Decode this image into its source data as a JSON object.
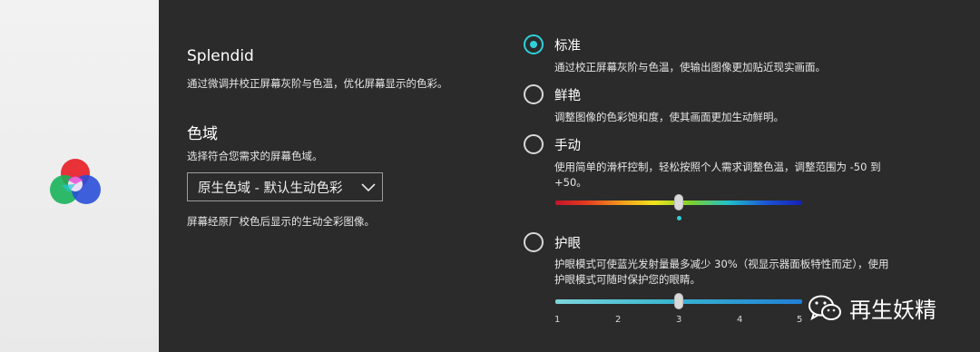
{
  "left": {
    "logo_icon": "color-gamut-logo"
  },
  "splendid": {
    "title": "Splendid",
    "description": "通过微调并校正屏幕灰阶与色温，优化屏幕显示的色彩。"
  },
  "gamut": {
    "title": "色域",
    "description": "选择符合您需求的屏幕色域。",
    "selected_value": "原生色域 - 默认生动色彩",
    "note": "屏幕经原厂校色后显示的生动全彩图像。"
  },
  "modes": [
    {
      "label": "标准",
      "selected": true,
      "description": [
        "通过校正屏幕灰阶与色温，使输出图像更加贴近现实画面。"
      ]
    },
    {
      "label": "鲜艳",
      "selected": false,
      "description": [
        "调整图像的色彩饱和度，使其画面更加生动鲜明。"
      ]
    },
    {
      "label": "手动",
      "selected": false,
      "description": [
        "使用简单的滑杆控制，轻松按照个人需求调整色温，调整范围为 -50 到",
        "+50。"
      ]
    },
    {
      "label": "护眼",
      "selected": false,
      "description": [
        "护眼模式可使蓝光发射量最多减少 30%（视显示器面板特性而定），使用",
        "护眼模式可随时保护您的眼睛。"
      ]
    }
  ],
  "manual_slider": {
    "value": 0,
    "min": -50,
    "max": 50,
    "accent": "#2fd0da"
  },
  "eyecare_slider": {
    "value": 3,
    "ticks": [
      "1",
      "2",
      "3",
      "4",
      "5"
    ]
  },
  "colors": {
    "accent": "#2fd0da",
    "background": "#2b2b2b"
  },
  "watermark": {
    "text": "再生妖精",
    "icon": "wechat-icon"
  }
}
